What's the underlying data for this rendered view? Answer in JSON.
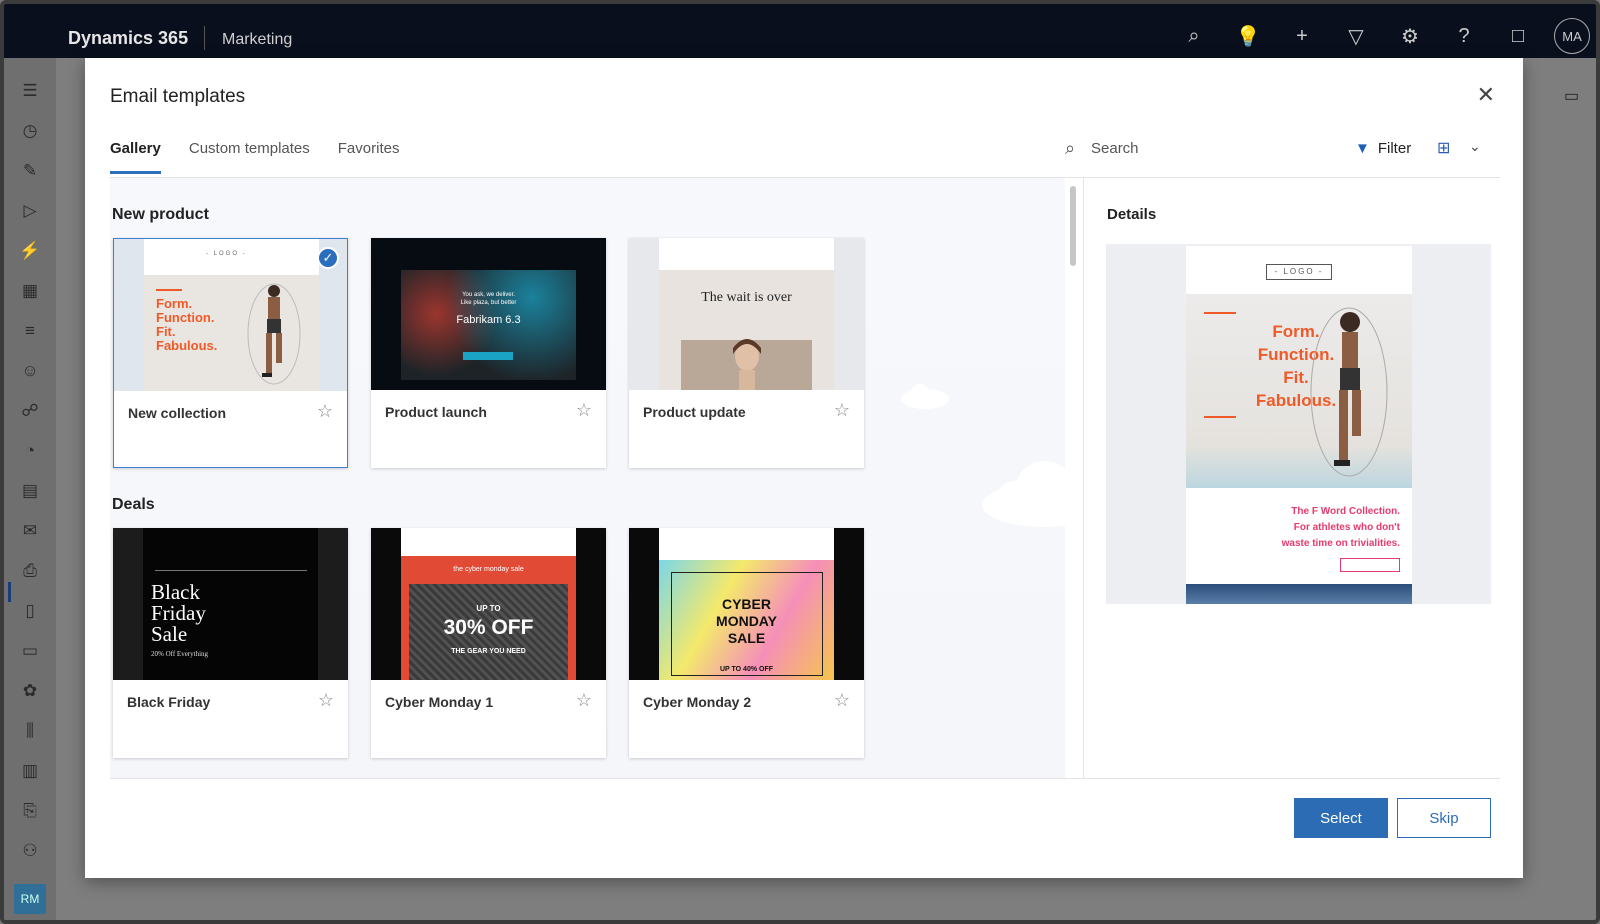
{
  "topbar": {
    "app_title": "Dynamics 365",
    "module": "Marketing",
    "icons": [
      "search-icon",
      "lightbulb-icon",
      "plus-icon",
      "filter-icon",
      "settings-icon",
      "help-icon",
      "chat-icon"
    ],
    "avatar_initials": "MA"
  },
  "leftnav": {
    "icons": [
      "hamburger-icon",
      "recent-icon",
      "pin-icon",
      "play-icon",
      "segments-icon",
      "building-icon",
      "forms-icon",
      "contact-icon",
      "journey-icon",
      "chart-icon",
      "list-icon",
      "email-icon",
      "document-icon",
      "device-icon",
      "message-icon",
      "settings-icon",
      "library-icon",
      "boards-icon",
      "clipboard-icon",
      "people-icon"
    ],
    "area_initials": "RM"
  },
  "modal": {
    "title": "Email templates",
    "tabs": [
      "Gallery",
      "Custom templates",
      "Favorites"
    ],
    "active_tab": "Gallery",
    "search_placeholder": "Search",
    "filter_label": "Filter",
    "sections": [
      {
        "title": "New product",
        "cards": [
          {
            "name": "New collection",
            "selected": true
          },
          {
            "name": "Product launch",
            "selected": false
          },
          {
            "name": "Product update",
            "selected": false
          }
        ]
      },
      {
        "title": "Deals",
        "cards": [
          {
            "name": "Black Friday",
            "selected": false
          },
          {
            "name": "Cyber Monday 1",
            "selected": false
          },
          {
            "name": "Cyber Monday 2",
            "selected": false
          }
        ]
      }
    ],
    "thumb_text": {
      "logo": "- LOGO -",
      "form_lines": [
        "Form.",
        "Function.",
        "Fit.",
        "Fabulous."
      ],
      "launch_line1": "You ask, we deliver.",
      "launch_line2": "Like plaza, but better",
      "launch_product": "Fabrikam 6.3",
      "update_heading": "The wait is over",
      "bf_lines": [
        "Black",
        "Friday",
        "Sale"
      ],
      "bf_sub": "20% Off Everything",
      "cm1_top": "the cyber monday sale",
      "cm1_upto": "UP TO",
      "cm1_big": "30% OFF",
      "cm1_sub": "THE GEAR YOU NEED",
      "cm2_lines": [
        "CYBER",
        "MONDAY",
        "SALE"
      ],
      "cm2_sub": "UP TO 40% OFF"
    },
    "details": {
      "label": "Details",
      "logo": "- LOGO -",
      "hero_lines": [
        "Form.",
        "Function.",
        "Fit.",
        "Fabulous."
      ],
      "collection_lines": [
        "The F Word Collection.",
        "For athletes who don't",
        "waste time on trivialities."
      ]
    },
    "buttons": {
      "select": "Select",
      "skip": "Skip"
    }
  },
  "colors": {
    "accent": "#2b6cb5",
    "orange": "#f05a28",
    "topbar": "#0a0f1e"
  }
}
